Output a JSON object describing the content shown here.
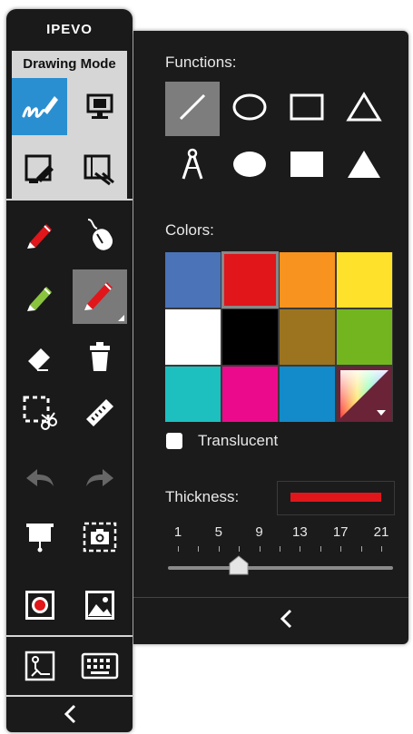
{
  "toolbar": {
    "brand": "IPEVO",
    "mode_label": "Drawing Mode",
    "tools": [
      {
        "name": "drawing-mode",
        "icon": "pen-scribble-icon",
        "selected": true
      },
      {
        "name": "desktop-mode",
        "icon": "monitor-icon"
      },
      {
        "name": "annotation-mode",
        "icon": "annotate-screen-icon"
      },
      {
        "name": "whiteboard-mode",
        "icon": "whiteboard-pointer-icon"
      },
      {
        "name": "red-pen",
        "icon": "red-pen-icon"
      },
      {
        "name": "mouse",
        "icon": "mouse-icon"
      },
      {
        "name": "green-pen",
        "icon": "green-pen-icon"
      },
      {
        "name": "shape-pen",
        "icon": "line-tool-icon",
        "selected": true
      },
      {
        "name": "eraser",
        "icon": "eraser-icon"
      },
      {
        "name": "trash",
        "icon": "trash-icon"
      },
      {
        "name": "cut-select",
        "icon": "scissors-select-icon"
      },
      {
        "name": "ruler",
        "icon": "ruler-icon"
      },
      {
        "name": "undo",
        "icon": "undo-arrow-icon"
      },
      {
        "name": "redo",
        "icon": "redo-arrow-icon"
      },
      {
        "name": "presentation",
        "icon": "projector-screen-icon"
      },
      {
        "name": "screenshot",
        "icon": "camera-capture-icon"
      },
      {
        "name": "record",
        "icon": "record-icon"
      },
      {
        "name": "image",
        "icon": "image-icon"
      },
      {
        "name": "pointer",
        "icon": "pointer-icon"
      },
      {
        "name": "keyboard",
        "icon": "keyboard-icon"
      }
    ],
    "collapse_icon": "chevron-left-icon"
  },
  "panel": {
    "functions_label": "Functions:",
    "colors_label": "Colors:",
    "translucent_label": "Translucent",
    "translucent_checked": false,
    "thickness_label": "Thickness:",
    "thickness_scale": [
      "1",
      "5",
      "9",
      "13",
      "17",
      "21"
    ],
    "thickness_value": 7,
    "thickness_color": "#e0161b",
    "functions": [
      {
        "icon": "line-icon",
        "selected": true
      },
      {
        "icon": "ellipse-outline-icon"
      },
      {
        "icon": "rectangle-outline-icon"
      },
      {
        "icon": "triangle-outline-icon"
      },
      {
        "icon": "compass-icon"
      },
      {
        "icon": "ellipse-filled-icon"
      },
      {
        "icon": "rectangle-filled-icon"
      },
      {
        "icon": "triangle-filled-icon"
      }
    ],
    "colors": [
      "#4a73b8",
      "#e0161b",
      "#f7931e",
      "#fde12a",
      "#ffffff",
      "#000000",
      "#9c7420",
      "#72b51e",
      "#1dbfbf",
      "#ec0a8c",
      "#138ac9",
      "custom-gradient"
    ],
    "selected_color": "#e0161b",
    "collapse_icon": "chevron-left-icon"
  }
}
